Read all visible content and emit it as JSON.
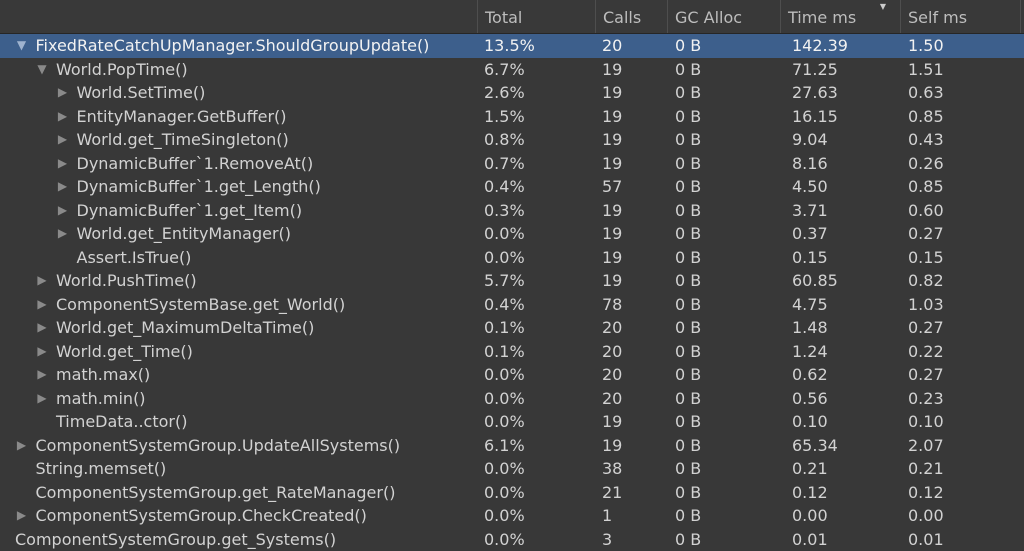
{
  "columns": {
    "name": "",
    "total": "Total",
    "calls": "Calls",
    "gc": "GC Alloc",
    "time": "Time ms",
    "self": "Self ms",
    "sorted_by": "Time ms"
  },
  "rows": [
    {
      "depth": 1,
      "arrow": "expanded",
      "selected": true,
      "name": "FixedRateCatchUpManager.ShouldGroupUpdate()",
      "total": "13.5%",
      "calls": "20",
      "gc": "0 B",
      "time": "142.39",
      "self": "1.50"
    },
    {
      "depth": 2,
      "arrow": "expanded",
      "name": "World.PopTime()",
      "total": "6.7%",
      "calls": "19",
      "gc": "0 B",
      "time": "71.25",
      "self": "1.51"
    },
    {
      "depth": 3,
      "arrow": "collapsed",
      "name": "World.SetTime()",
      "total": "2.6%",
      "calls": "19",
      "gc": "0 B",
      "time": "27.63",
      "self": "0.63"
    },
    {
      "depth": 3,
      "arrow": "collapsed",
      "name": "EntityManager.GetBuffer()",
      "total": "1.5%",
      "calls": "19",
      "gc": "0 B",
      "time": "16.15",
      "self": "0.85"
    },
    {
      "depth": 3,
      "arrow": "collapsed",
      "name": "World.get_TimeSingleton()",
      "total": "0.8%",
      "calls": "19",
      "gc": "0 B",
      "time": "9.04",
      "self": "0.43"
    },
    {
      "depth": 3,
      "arrow": "collapsed",
      "name": "DynamicBuffer`1.RemoveAt()",
      "total": "0.7%",
      "calls": "19",
      "gc": "0 B",
      "time": "8.16",
      "self": "0.26"
    },
    {
      "depth": 3,
      "arrow": "collapsed",
      "name": "DynamicBuffer`1.get_Length()",
      "total": "0.4%",
      "calls": "57",
      "gc": "0 B",
      "time": "4.50",
      "self": "0.85"
    },
    {
      "depth": 3,
      "arrow": "collapsed",
      "name": "DynamicBuffer`1.get_Item()",
      "total": "0.3%",
      "calls": "19",
      "gc": "0 B",
      "time": "3.71",
      "self": "0.60"
    },
    {
      "depth": 3,
      "arrow": "collapsed",
      "name": "World.get_EntityManager()",
      "total": "0.0%",
      "calls": "19",
      "gc": "0 B",
      "time": "0.37",
      "self": "0.27"
    },
    {
      "depth": 3,
      "arrow": "none",
      "name": "Assert.IsTrue()",
      "total": "0.0%",
      "calls": "19",
      "gc": "0 B",
      "time": "0.15",
      "self": "0.15"
    },
    {
      "depth": 2,
      "arrow": "collapsed",
      "name": "World.PushTime()",
      "total": "5.7%",
      "calls": "19",
      "gc": "0 B",
      "time": "60.85",
      "self": "0.82"
    },
    {
      "depth": 2,
      "arrow": "collapsed",
      "name": "ComponentSystemBase.get_World()",
      "total": "0.4%",
      "calls": "78",
      "gc": "0 B",
      "time": "4.75",
      "self": "1.03"
    },
    {
      "depth": 2,
      "arrow": "collapsed",
      "name": "World.get_MaximumDeltaTime()",
      "total": "0.1%",
      "calls": "20",
      "gc": "0 B",
      "time": "1.48",
      "self": "0.27"
    },
    {
      "depth": 2,
      "arrow": "collapsed",
      "name": "World.get_Time()",
      "total": "0.1%",
      "calls": "20",
      "gc": "0 B",
      "time": "1.24",
      "self": "0.22"
    },
    {
      "depth": 2,
      "arrow": "collapsed",
      "name": "math.max()",
      "total": "0.0%",
      "calls": "20",
      "gc": "0 B",
      "time": "0.62",
      "self": "0.27"
    },
    {
      "depth": 2,
      "arrow": "collapsed",
      "name": "math.min()",
      "total": "0.0%",
      "calls": "20",
      "gc": "0 B",
      "time": "0.56",
      "self": "0.23"
    },
    {
      "depth": 2,
      "arrow": "none",
      "name": "TimeData..ctor()",
      "total": "0.0%",
      "calls": "19",
      "gc": "0 B",
      "time": "0.10",
      "self": "0.10"
    },
    {
      "depth": 1,
      "arrow": "collapsed",
      "name": "ComponentSystemGroup.UpdateAllSystems()",
      "total": "6.1%",
      "calls": "19",
      "gc": "0 B",
      "time": "65.34",
      "self": "2.07"
    },
    {
      "depth": 1,
      "arrow": "none",
      "name": "String.memset()",
      "total": "0.0%",
      "calls": "38",
      "gc": "0 B",
      "time": "0.21",
      "self": "0.21"
    },
    {
      "depth": 1,
      "arrow": "none",
      "name": "ComponentSystemGroup.get_RateManager()",
      "total": "0.0%",
      "calls": "21",
      "gc": "0 B",
      "time": "0.12",
      "self": "0.12"
    },
    {
      "depth": 1,
      "arrow": "collapsed",
      "name": "ComponentSystemGroup.CheckCreated()",
      "total": "0.0%",
      "calls": "1",
      "gc": "0 B",
      "time": "0.00",
      "self": "0.00"
    },
    {
      "depth": 0,
      "arrow": "none",
      "name": "ComponentSystemGroup.get_Systems()",
      "total": "0.0%",
      "calls": "3",
      "gc": "0 B",
      "time": "0.01",
      "self": "0.01"
    }
  ]
}
